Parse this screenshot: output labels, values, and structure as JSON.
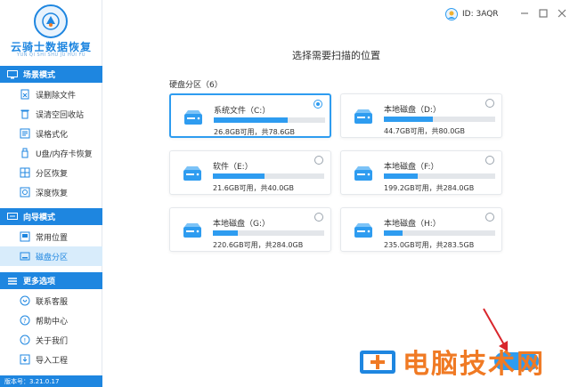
{
  "app": {
    "logo_title": "云骑士数据恢复",
    "logo_subtitle": "YUN QI SHI SHU JU HUI FU",
    "version": "版本号：3.21.0.17"
  },
  "topbar": {
    "user_id": "ID: 3AQR"
  },
  "sidebar": {
    "sections": [
      {
        "title": "场景模式",
        "items": [
          {
            "label": "误删除文件",
            "icon": "delete-file-icon"
          },
          {
            "label": "误清空回收站",
            "icon": "recycle-bin-icon"
          },
          {
            "label": "误格式化",
            "icon": "format-icon"
          },
          {
            "label": "U盘/内存卡恢复",
            "icon": "usb-drive-icon"
          },
          {
            "label": "分区恢复",
            "icon": "partition-icon"
          },
          {
            "label": "深度恢复",
            "icon": "deep-scan-icon"
          }
        ]
      },
      {
        "title": "向导模式",
        "items": [
          {
            "label": "常用位置",
            "icon": "location-icon"
          },
          {
            "label": "磁盘分区",
            "icon": "disk-icon",
            "active": true
          }
        ]
      },
      {
        "title": "更多选项",
        "items": [
          {
            "label": "联系客服",
            "icon": "support-icon"
          },
          {
            "label": "帮助中心",
            "icon": "help-icon"
          },
          {
            "label": "关于我们",
            "icon": "info-icon"
          },
          {
            "label": "导入工程",
            "icon": "import-icon"
          }
        ]
      }
    ]
  },
  "main": {
    "title": "选择需要扫描的位置",
    "section_label": "硬盘分区（6）",
    "drives": [
      {
        "name": "系统文件（C:）",
        "free": "26.8GB可用，共78.6GB",
        "used_fraction": 0.66,
        "selected": true
      },
      {
        "name": "本地磁盘（D:）",
        "free": "44.7GB可用，共80.0GB",
        "used_fraction": 0.44,
        "selected": false
      },
      {
        "name": "软件（E:）",
        "free": "21.6GB可用，共40.0GB",
        "used_fraction": 0.46,
        "selected": false
      },
      {
        "name": "本地磁盘（F:）",
        "free": "199.2GB可用，共284.0GB",
        "used_fraction": 0.3,
        "selected": false
      },
      {
        "name": "本地磁盘（G:）",
        "free": "220.6GB可用，共284.0GB",
        "used_fraction": 0.22,
        "selected": false
      },
      {
        "name": "本地磁盘（H:）",
        "free": "235.0GB可用，共283.5GB",
        "used_fraction": 0.17,
        "selected": false
      }
    ]
  },
  "watermark": {
    "text": "电脑技术网"
  },
  "colors": {
    "accent": "#1e86e0",
    "bar_fill": "#2e9cf0",
    "watermark": "#f07a24"
  }
}
